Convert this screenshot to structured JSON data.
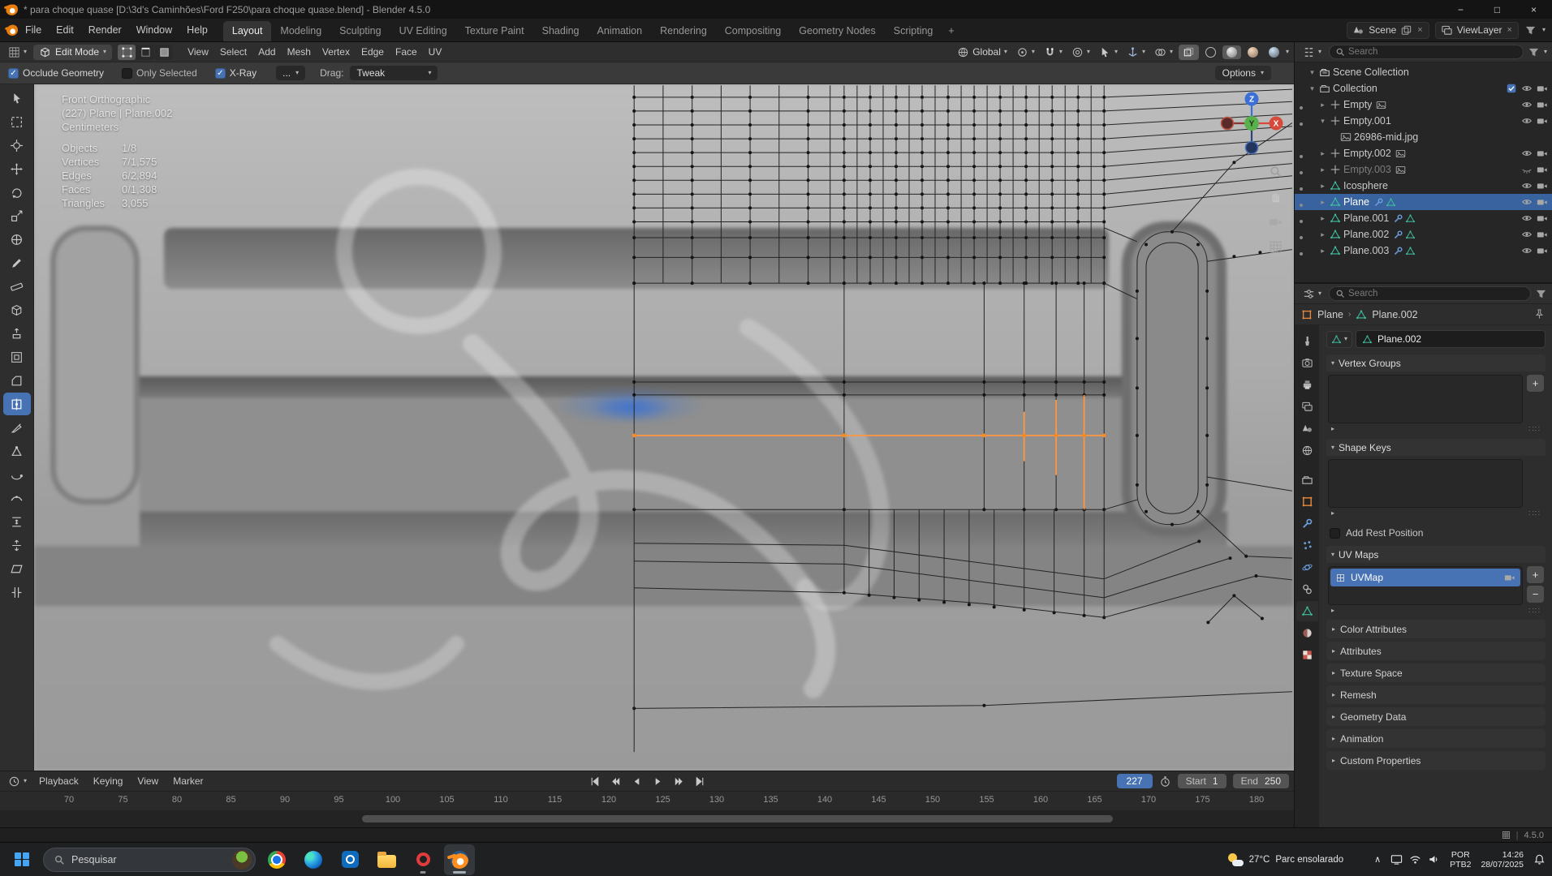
{
  "titlebar": {
    "title": "* para choque quase [D:\\3d's Caminhões\\Ford F250\\para choque quase.blend] - Blender 4.5.0",
    "minimize": "−",
    "maximize": "□",
    "close": "×"
  },
  "menubar": {
    "menus": [
      "File",
      "Edit",
      "Render",
      "Window",
      "Help"
    ],
    "workspaces": [
      "Layout",
      "Modeling",
      "Sculpting",
      "UV Editing",
      "Texture Paint",
      "Shading",
      "Animation",
      "Rendering",
      "Compositing",
      "Geometry Nodes",
      "Scripting"
    ],
    "active_workspace": "Layout",
    "new_workspace": "+",
    "scene": "Scene",
    "view_layer": "ViewLayer"
  },
  "viewport_header": {
    "mode": "Edit Mode",
    "menus": [
      "View",
      "Select",
      "Add",
      "Mesh",
      "Vertex",
      "Edge",
      "Face",
      "UV"
    ],
    "orientation": "Global"
  },
  "tool_settings": {
    "occlude_geometry": "Occlude Geometry",
    "only_selected": "Only Selected",
    "x_ray": "X-Ray",
    "more": "...",
    "drag_label": "Drag:",
    "drag_value": "Tweak",
    "options": "Options"
  },
  "tool_rail": {
    "active": "loop-cut",
    "tools": [
      "tweak",
      "select-box",
      "cursor",
      "move",
      "rotate",
      "scale",
      "transform",
      "annotate",
      "measure",
      "add-cube",
      "extrude",
      "inset",
      "bevel",
      "loop-cut",
      "knife",
      "poly-build",
      "spin",
      "smooth",
      "edge-slide",
      "shrink-fatten",
      "shear",
      "rip"
    ]
  },
  "viewport": {
    "view_name": "Front Orthographic",
    "context_line": "(227) Plane | Plane.002",
    "units": "Centimeters",
    "stats": [
      {
        "label": "Objects",
        "value": "1/8"
      },
      {
        "label": "Vertices",
        "value": "7/1,575"
      },
      {
        "label": "Edges",
        "value": "6/2,894"
      },
      {
        "label": "Faces",
        "value": "0/1,308"
      },
      {
        "label": "Triangles",
        "value": "3,055"
      }
    ],
    "axis_z": "Z",
    "axis_y": "Y",
    "axis_x": "X"
  },
  "outliner": {
    "search_placeholder": "Search",
    "scene_row": "Scene Collection",
    "rows": [
      {
        "label": "Collection",
        "depth": 1,
        "icon": "collection",
        "arrow": "down",
        "right": [
          "check",
          "eye",
          "camera"
        ]
      },
      {
        "label": "Empty",
        "depth": 2,
        "icon": "empty",
        "arrow": "right",
        "tags": [
          "image"
        ],
        "right": [
          "eye",
          "camera"
        ]
      },
      {
        "label": "Empty.001",
        "depth": 2,
        "icon": "empty",
        "arrow": "down",
        "right": [
          "eye",
          "camera"
        ]
      },
      {
        "label": "26986-mid.jpg",
        "depth": 3,
        "icon": "image",
        "right": []
      },
      {
        "label": "Empty.002",
        "depth": 2,
        "icon": "empty",
        "arrow": "right",
        "tags": [
          "image"
        ],
        "right": [
          "eye",
          "camera"
        ]
      },
      {
        "label": "Empty.003",
        "depth": 2,
        "icon": "empty",
        "arrow": "right",
        "muted": true,
        "tags": [
          "image"
        ],
        "right": [
          "eye-off",
          "camera"
        ]
      },
      {
        "label": "Icosphere",
        "depth": 2,
        "icon": "mesh",
        "arrow": "right",
        "right": [
          "eye",
          "camera"
        ]
      },
      {
        "label": "Plane",
        "depth": 2,
        "icon": "mesh",
        "arrow": "right",
        "active": true,
        "tags": [
          "wrench",
          "data"
        ],
        "right": [
          "eye",
          "camera"
        ]
      },
      {
        "label": "Plane.001",
        "depth": 2,
        "icon": "mesh",
        "arrow": "right",
        "tags": [
          "wrench",
          "data"
        ],
        "right": [
          "eye",
          "camera"
        ]
      },
      {
        "label": "Plane.002",
        "depth": 2,
        "icon": "mesh",
        "arrow": "right",
        "tags": [
          "wrench",
          "data"
        ],
        "right": [
          "eye",
          "camera"
        ]
      },
      {
        "label": "Plane.003",
        "depth": 2,
        "icon": "mesh",
        "arrow": "right",
        "tags": [
          "wrench",
          "data"
        ],
        "right": [
          "eye",
          "camera"
        ]
      }
    ]
  },
  "properties": {
    "search_placeholder": "Search",
    "breadcrumb_object": "Plane",
    "breadcrumb_data": "Plane.002",
    "name_value": "Plane.002",
    "tabs": [
      "tool",
      "render",
      "output",
      "view-layer",
      "scene",
      "world",
      "collection",
      "object",
      "modifiers",
      "particles",
      "physics",
      "constraints",
      "object-data",
      "material",
      "texture"
    ],
    "active_tab": "object-data",
    "sections": [
      {
        "kind": "list",
        "label": "Vertex Groups",
        "buttons": [
          "+"
        ],
        "items": []
      },
      {
        "kind": "list",
        "label": "Shape Keys",
        "buttons": [],
        "items": []
      },
      {
        "kind": "checkbox",
        "label": "Add Rest Position",
        "checked": false
      },
      {
        "kind": "list",
        "label": "UV Maps",
        "buttons": [
          "+",
          "−"
        ],
        "items": [
          {
            "label": "UVMap",
            "selected": true
          }
        ]
      },
      {
        "kind": "collapsed",
        "label": "Color Attributes"
      },
      {
        "kind": "collapsed",
        "label": "Attributes"
      },
      {
        "kind": "collapsed",
        "label": "Texture Space"
      },
      {
        "kind": "collapsed",
        "label": "Remesh"
      },
      {
        "kind": "collapsed",
        "label": "Geometry Data"
      },
      {
        "kind": "collapsed",
        "label": "Animation"
      },
      {
        "kind": "collapsed",
        "label": "Custom Properties"
      }
    ]
  },
  "timeline": {
    "menus": [
      "Playback",
      "Keying",
      "View",
      "Marker"
    ],
    "current_frame": "227",
    "start_label": "Start",
    "start_value": "1",
    "end_label": "End",
    "end_value": "250",
    "ticks": [
      "70",
      "75",
      "80",
      "85",
      "90",
      "95",
      "100",
      "105",
      "110",
      "115",
      "120",
      "125",
      "130",
      "135",
      "140",
      "145",
      "150",
      "155",
      "160",
      "165",
      "170",
      "175",
      "180"
    ]
  },
  "statusbar": {
    "version": "4.5.0"
  },
  "taskbar": {
    "search_placeholder": "Pesquisar",
    "weather_temp": "27°C",
    "weather_desc": "Parc ensolarado",
    "tray_lang_top": "POR",
    "tray_lang_bottom": "PTB2",
    "tray_time": "14:26",
    "tray_date": "28/07/2025"
  },
  "colors": {
    "accent_blue": "#4772b3",
    "selection_orange": "#ff8a1e",
    "blender_orange": "#e87d0d"
  }
}
